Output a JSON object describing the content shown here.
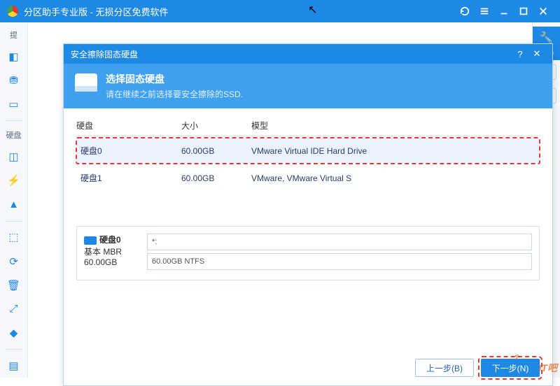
{
  "titlebar": {
    "title": "分区助手专业版 - 无损分区免费软件"
  },
  "tools": {
    "label": "工具"
  },
  "sidebar": {
    "apply_label": "提",
    "section_label": "硬盘"
  },
  "dialog": {
    "title": "安全擦除固态硬盘",
    "heading": "选择固态硬盘",
    "subheading": "请在继续之前选择要安全擦除的SSD.",
    "columns": {
      "disk": "硬盘",
      "size": "大小",
      "model": "模型"
    },
    "rows": [
      {
        "name": "硬盘0",
        "size": "60.00GB",
        "model": "VMware Virtual IDE Hard Drive"
      },
      {
        "name": "硬盘1",
        "size": "60.00GB",
        "model": "VMware, VMware Virtual S"
      }
    ],
    "detail": {
      "disk_name": "硬盘0",
      "type_line": "基本 MBR",
      "total": "60.00GB",
      "part0_label": "*:",
      "part1_label": "60.00GB NTFS"
    },
    "buttons": {
      "back": "上一步(B)",
      "next": "下一步(N)"
    }
  },
  "watermark": "IT吧",
  "watermark2": "ร"
}
